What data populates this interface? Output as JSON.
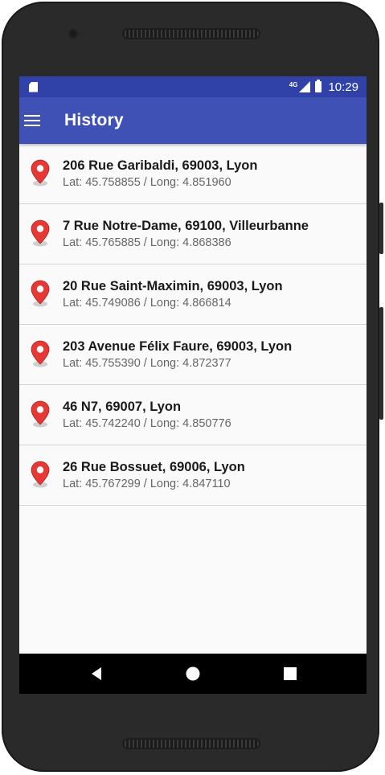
{
  "status_bar": {
    "network_label": "4G",
    "time": "10:29",
    "icons": [
      "sd-card-icon",
      "signal-icon",
      "battery-icon"
    ]
  },
  "app_bar": {
    "menu_icon": "hamburger-menu-icon",
    "title": "History"
  },
  "colors": {
    "primary": "#3f51b5",
    "primary_dark": "#3041a8",
    "pin_red": "#e53935"
  },
  "history": [
    {
      "address": "206 Rue Garibaldi, 69003, Lyon",
      "coords": "Lat: 45.758855 / Long: 4.851960"
    },
    {
      "address": "7 Rue Notre-Dame, 69100, Villeurbanne",
      "coords": "Lat: 45.765885 / Long: 4.868386"
    },
    {
      "address": "20 Rue Saint-Maximin, 69003, Lyon",
      "coords": "Lat: 45.749086 / Long: 4.866814"
    },
    {
      "address": "203 Avenue Félix Faure, 69003, Lyon",
      "coords": "Lat: 45.755390 / Long: 4.872377"
    },
    {
      "address": "46 N7, 69007, Lyon",
      "coords": "Lat: 45.742240 / Long: 4.850776"
    },
    {
      "address": "26 Rue Bossuet, 69006, Lyon",
      "coords": "Lat: 45.767299 / Long: 4.847110"
    }
  ],
  "nav_bar": {
    "buttons": [
      "back-icon",
      "home-icon",
      "recents-icon"
    ]
  }
}
